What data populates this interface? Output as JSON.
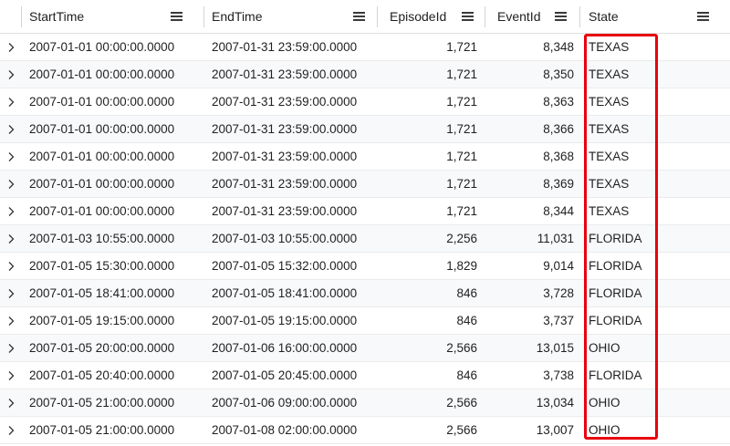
{
  "columns": {
    "start_time": "StartTime",
    "end_time": "EndTime",
    "episode_id": "EpisodeId",
    "event_id": "EventId",
    "state": "State"
  },
  "colors": {
    "highlight": "#e8000d",
    "row_alt": "#f7f9fb",
    "border": "#e1e1e1"
  },
  "icons": {
    "column_menu": "hamburger-menu-icon",
    "row_expander": "chevron-right-icon"
  },
  "rows": [
    {
      "start": "2007-01-01 00:00:00.0000",
      "end": "2007-01-31 23:59:00.0000",
      "episode": "1,721",
      "event": "8,348",
      "state": "TEXAS"
    },
    {
      "start": "2007-01-01 00:00:00.0000",
      "end": "2007-01-31 23:59:00.0000",
      "episode": "1,721",
      "event": "8,350",
      "state": "TEXAS"
    },
    {
      "start": "2007-01-01 00:00:00.0000",
      "end": "2007-01-31 23:59:00.0000",
      "episode": "1,721",
      "event": "8,363",
      "state": "TEXAS"
    },
    {
      "start": "2007-01-01 00:00:00.0000",
      "end": "2007-01-31 23:59:00.0000",
      "episode": "1,721",
      "event": "8,366",
      "state": "TEXAS"
    },
    {
      "start": "2007-01-01 00:00:00.0000",
      "end": "2007-01-31 23:59:00.0000",
      "episode": "1,721",
      "event": "8,368",
      "state": "TEXAS"
    },
    {
      "start": "2007-01-01 00:00:00.0000",
      "end": "2007-01-31 23:59:00.0000",
      "episode": "1,721",
      "event": "8,369",
      "state": "TEXAS"
    },
    {
      "start": "2007-01-01 00:00:00.0000",
      "end": "2007-01-31 23:59:00.0000",
      "episode": "1,721",
      "event": "8,344",
      "state": "TEXAS"
    },
    {
      "start": "2007-01-03 10:55:00.0000",
      "end": "2007-01-03 10:55:00.0000",
      "episode": "2,256",
      "event": "11,031",
      "state": "FLORIDA"
    },
    {
      "start": "2007-01-05 15:30:00.0000",
      "end": "2007-01-05 15:32:00.0000",
      "episode": "1,829",
      "event": "9,014",
      "state": "FLORIDA"
    },
    {
      "start": "2007-01-05 18:41:00.0000",
      "end": "2007-01-05 18:41:00.0000",
      "episode": "846",
      "event": "3,728",
      "state": "FLORIDA"
    },
    {
      "start": "2007-01-05 19:15:00.0000",
      "end": "2007-01-05 19:15:00.0000",
      "episode": "846",
      "event": "3,737",
      "state": "FLORIDA"
    },
    {
      "start": "2007-01-05 20:00:00.0000",
      "end": "2007-01-06 16:00:00.0000",
      "episode": "2,566",
      "event": "13,015",
      "state": "OHIO"
    },
    {
      "start": "2007-01-05 20:40:00.0000",
      "end": "2007-01-05 20:45:00.0000",
      "episode": "846",
      "event": "3,738",
      "state": "FLORIDA"
    },
    {
      "start": "2007-01-05 21:00:00.0000",
      "end": "2007-01-06 09:00:00.0000",
      "episode": "2,566",
      "event": "13,034",
      "state": "OHIO"
    },
    {
      "start": "2007-01-05 21:00:00.0000",
      "end": "2007-01-08 02:00:00.0000",
      "episode": "2,566",
      "event": "13,007",
      "state": "OHIO"
    }
  ]
}
